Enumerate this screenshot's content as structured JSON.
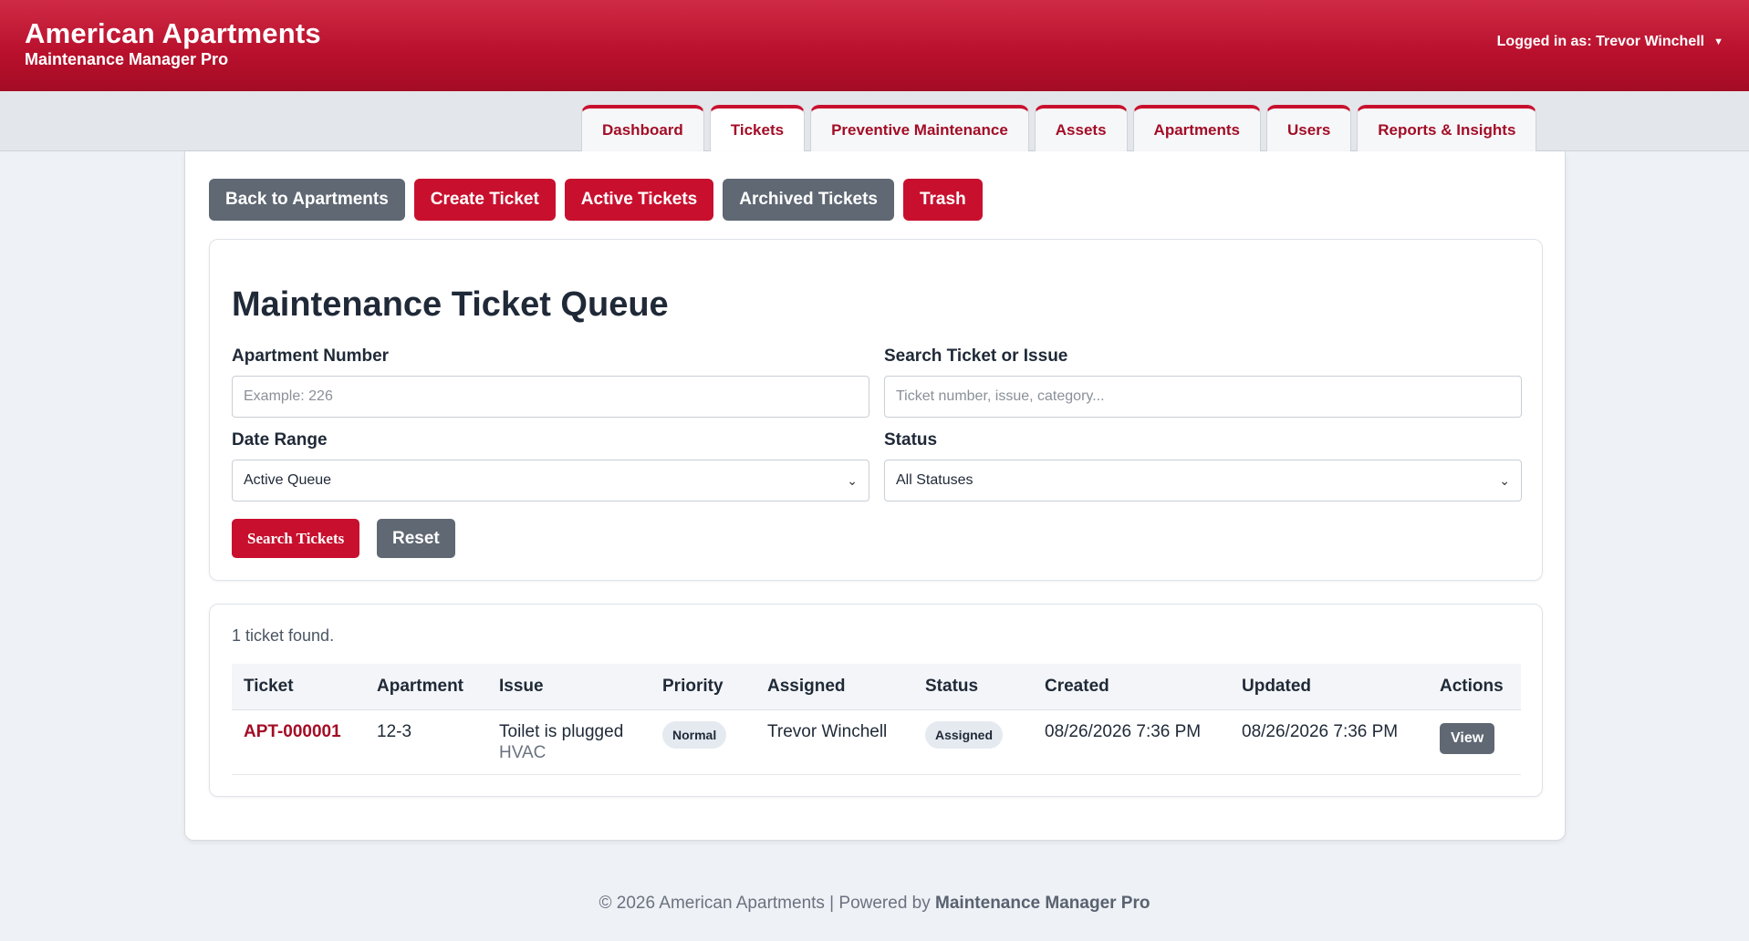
{
  "header": {
    "brand_title": "American Apartments",
    "brand_subtitle": "Maintenance Manager Pro",
    "user_label": "Logged in as: Trevor Winchell",
    "user_caret": "▼"
  },
  "nav": {
    "tabs": [
      {
        "label": "Dashboard",
        "active": false
      },
      {
        "label": "Tickets",
        "active": true
      },
      {
        "label": "Preventive Maintenance",
        "active": false
      },
      {
        "label": "Assets",
        "active": false
      },
      {
        "label": "Apartments",
        "active": false
      },
      {
        "label": "Users",
        "active": false
      },
      {
        "label": "Reports & Insights",
        "active": false
      }
    ]
  },
  "actions": {
    "back": "Back to Apartments",
    "create": "Create Ticket",
    "active": "Active Tickets",
    "archived": "Archived Tickets",
    "trash": "Trash"
  },
  "filters": {
    "title": "Maintenance Ticket Queue",
    "apartment_label": "Apartment Number",
    "apartment_placeholder": "Example: 226",
    "search_label": "Search Ticket or Issue",
    "search_placeholder": "Ticket number, issue, category...",
    "date_label": "Date Range",
    "date_value": "Active Queue",
    "status_label": "Status",
    "status_value": "All Statuses",
    "search_button": "Search Tickets",
    "reset_button": "Reset"
  },
  "results": {
    "count_text": "1 ticket found.",
    "columns": [
      "Ticket",
      "Apartment",
      "Issue",
      "Priority",
      "Assigned",
      "Status",
      "Created",
      "Updated",
      "Actions"
    ],
    "rows": [
      {
        "ticket": "APT-000001",
        "apartment": "12-3",
        "issue": "Toilet is plugged",
        "category": "HVAC",
        "priority": "Normal",
        "assigned": "Trevor Winchell",
        "status": "Assigned",
        "created": "08/26/2026 7:36 PM",
        "updated": "08/26/2026 7:36 PM",
        "action": "View"
      }
    ]
  },
  "footer": {
    "text": "© 2026 American Apartments | Powered by",
    "brand": "Maintenance Manager Pro"
  },
  "colors": {
    "brand_red": "#c8102e",
    "dark_red": "#a30d26",
    "slate_gray": "#5f6873"
  }
}
